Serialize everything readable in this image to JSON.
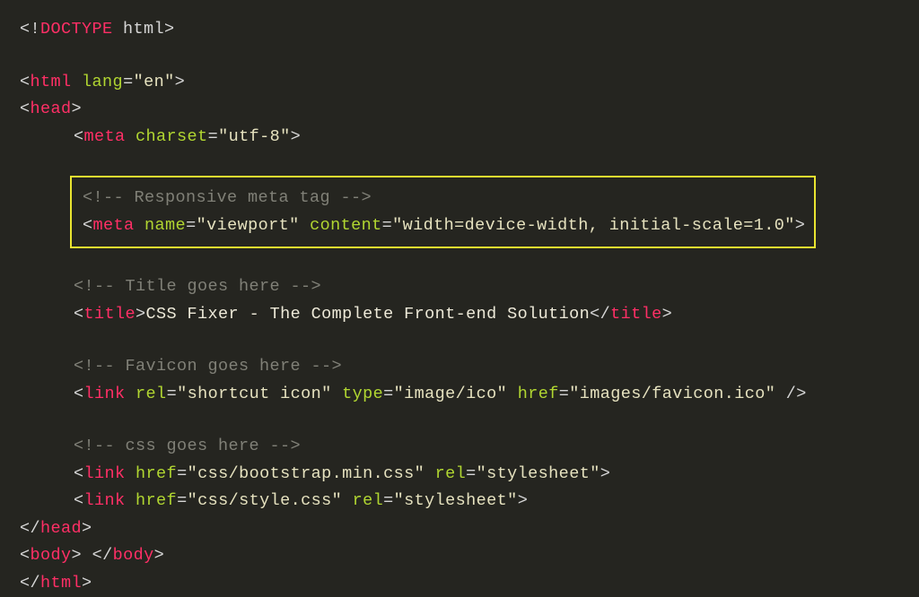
{
  "code": {
    "doctype": {
      "open": "<!",
      "kw": "DOCTYPE",
      "rest": " html>"
    },
    "html_open": {
      "open": "<",
      "tag": "html",
      "sp": " ",
      "a1": "lang",
      "eq": "=",
      "v1": "\"en\"",
      "close": ">"
    },
    "head_open": {
      "open": "<",
      "tag": "head",
      "close": ">"
    },
    "head_close": {
      "open": "</",
      "tag": "head",
      "close": ">"
    },
    "body_tag": {
      "open": "<",
      "tag": "body",
      "close": ">",
      "sp": " ",
      "open2": "</",
      "tag2": "body",
      "close2": ">"
    },
    "html_close": {
      "open": "</",
      "tag": "html",
      "close": ">"
    },
    "meta1": {
      "open": "<",
      "tag": "meta",
      "sp": " ",
      "a1": "charset",
      "eq": "=",
      "v1": "\"utf-8\"",
      "close": ">"
    },
    "comment1": "<!-- Responsive meta tag -->",
    "meta2": {
      "open": "<",
      "tag": "meta",
      "sp": " ",
      "a1": "name",
      "eq1": "=",
      "v1": "\"viewport\"",
      "sp2": " ",
      "a2": "content",
      "eq2": "=",
      "v2": "\"width=device-width, initial-scale=1.0\"",
      "close": ">"
    },
    "comment2": "<!-- Title goes here -->",
    "title": {
      "open": "<",
      "tag": "title",
      "close": ">",
      "text": "CSS Fixer - The Complete Front-end Solution",
      "open2": "</",
      "tag2": "title",
      "close2": ">"
    },
    "comment3": "<!-- Favicon goes here -->",
    "link1": {
      "open": "<",
      "tag": "link",
      "sp": " ",
      "a1": "rel",
      "eq1": "=",
      "v1": "\"shortcut icon\"",
      "sp2": " ",
      "a2": "type",
      "eq2": "=",
      "v2": "\"image/ico\"",
      "sp3": " ",
      "a3": "href",
      "eq3": "=",
      "v3": "\"images/favicon.ico\"",
      "close": " />"
    },
    "comment4": "<!-- css goes here -->",
    "link2": {
      "open": "<",
      "tag": "link",
      "sp": " ",
      "a1": "href",
      "eq1": "=",
      "v1": "\"css/bootstrap.min.css\"",
      "sp2": " ",
      "a2": "rel",
      "eq2": "=",
      "v2": "\"stylesheet\"",
      "close": ">"
    },
    "link3": {
      "open": "<",
      "tag": "link",
      "sp": " ",
      "a1": "href",
      "eq1": "=",
      "v1": "\"css/style.css\"",
      "sp2": " ",
      "a2": "rel",
      "eq2": "=",
      "v2": "\"stylesheet\"",
      "close": ">"
    }
  }
}
